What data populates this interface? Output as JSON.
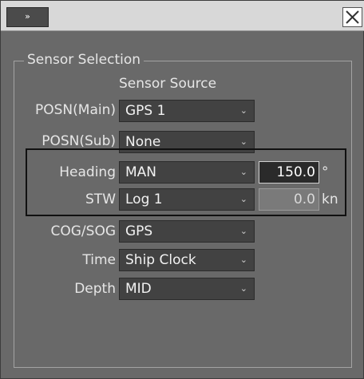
{
  "titlebar": {
    "collapse_glyph": "»"
  },
  "group": {
    "title": "Sensor Selection",
    "column_header": "Sensor Source"
  },
  "rows": [
    {
      "label": "POSN(Main)",
      "value": "GPS 1"
    },
    {
      "label": "POSN(Sub)",
      "value": "None"
    },
    {
      "label": "Heading",
      "value": "MAN",
      "number": "150.0",
      "unit": "°"
    },
    {
      "label": "STW",
      "value": "Log 1",
      "number": "0.0",
      "unit": "kn"
    },
    {
      "label": "COG/SOG",
      "value": "GPS"
    },
    {
      "label": "Time",
      "value": "Ship Clock"
    },
    {
      "label": "Depth",
      "value": "MID"
    }
  ],
  "dropdown_chevron": "⌄",
  "colors": {
    "panel_bg": "#696969",
    "dropdown_bg": "#424242",
    "titlebar_bg": "#d8d8d8"
  }
}
